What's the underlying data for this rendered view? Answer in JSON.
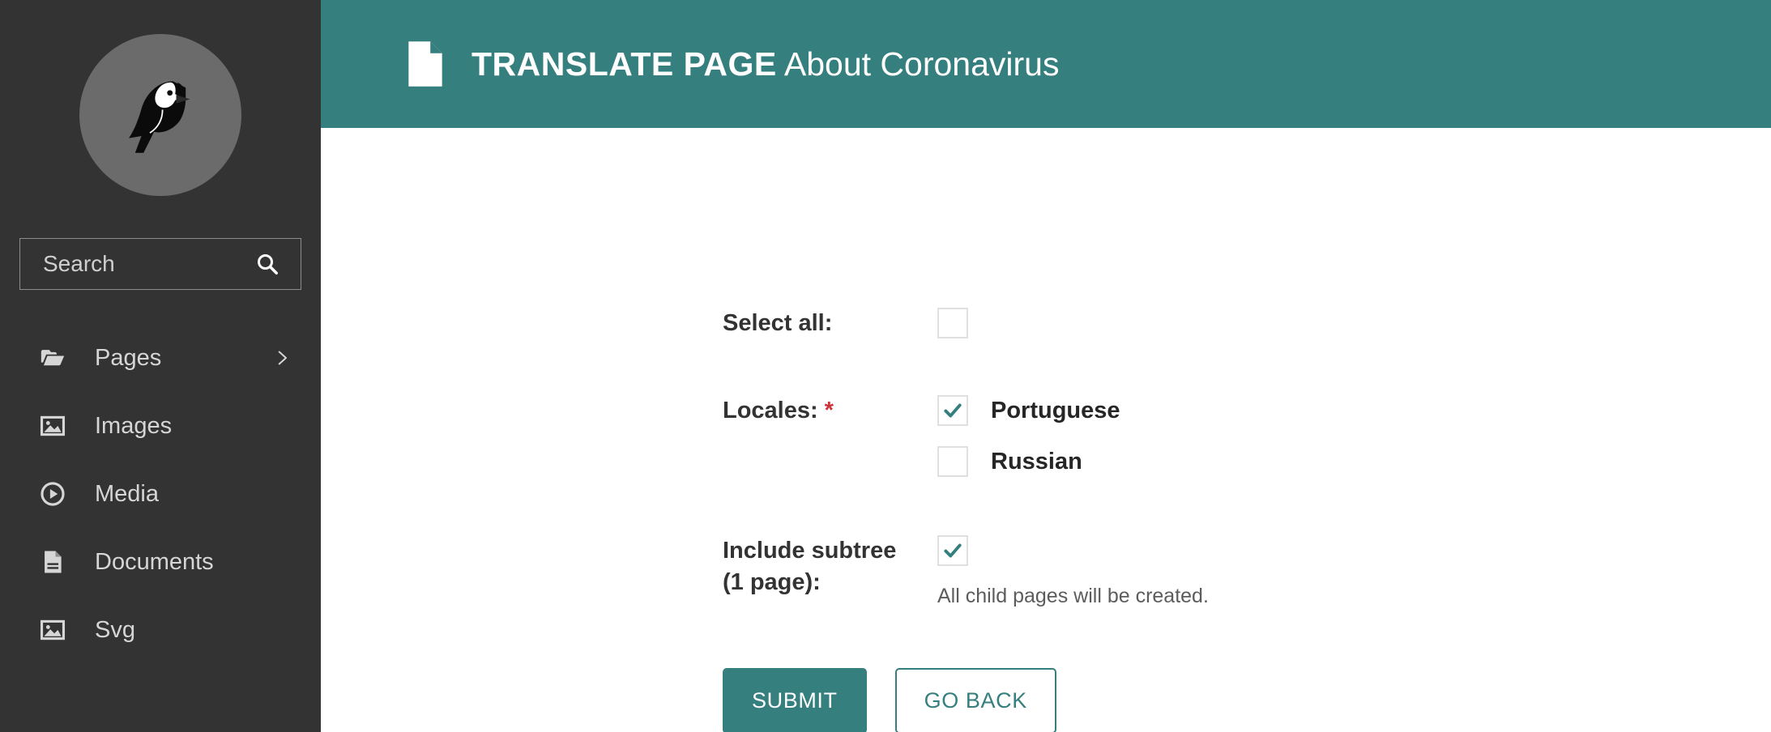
{
  "sidebar": {
    "logo": {
      "icon": "wagtail-bird-logo"
    },
    "search": {
      "placeholder": "Search",
      "value": "",
      "icon": "search-icon"
    },
    "items": [
      {
        "label": "Pages",
        "icon": "folder-open-icon",
        "has_chevron": true,
        "chevron_icon": "chevron-right-icon"
      },
      {
        "label": "Images",
        "icon": "image-icon",
        "has_chevron": false
      },
      {
        "label": "Media",
        "icon": "play-circle-icon",
        "has_chevron": false
      },
      {
        "label": "Documents",
        "icon": "document-icon",
        "has_chevron": false
      },
      {
        "label": "Svg",
        "icon": "image-icon",
        "has_chevron": false
      }
    ]
  },
  "header": {
    "icon": "page-document-icon",
    "title_strong": "TRANSLATE PAGE",
    "title_rest": " About Coronavirus"
  },
  "form": {
    "select_all": {
      "label": "Select all:",
      "checked": false
    },
    "locales": {
      "label": "Locales:",
      "required_marker": "*",
      "options": [
        {
          "label": "Portuguese",
          "checked": true
        },
        {
          "label": "Russian",
          "checked": false
        }
      ]
    },
    "include_subtree": {
      "label": "Include subtree (1 page):",
      "checked": true,
      "help_text": "All child pages will be created."
    },
    "actions": {
      "submit_label": "SUBMIT",
      "go_back_label": "GO BACK"
    }
  },
  "colors": {
    "teal": "#367f7f",
    "sidebar_bg": "#333333",
    "required_red": "#cd3238",
    "checkbox_border": "#e0e0e0",
    "help_text": "#5c5c5c"
  }
}
